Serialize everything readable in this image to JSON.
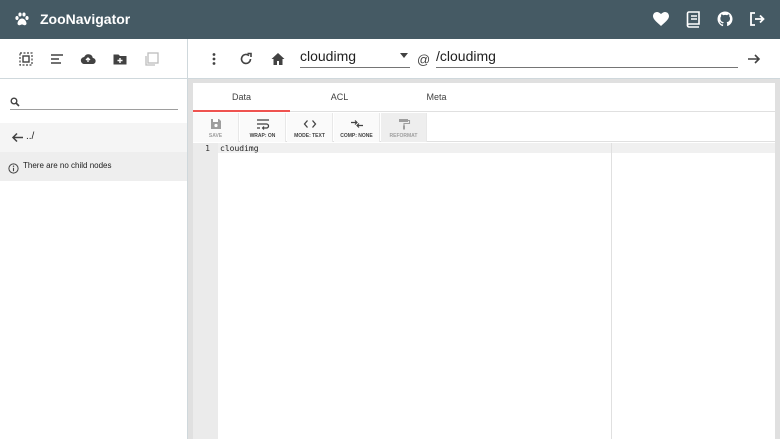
{
  "app": {
    "title": "ZooNavigator"
  },
  "sidebar": {
    "search_placeholder": "",
    "parent_label": "../",
    "empty_message": "There are no child nodes"
  },
  "node": {
    "selected": "cloudimg",
    "path": "/cloudimg"
  },
  "tabs": [
    {
      "label": "Data"
    },
    {
      "label": "ACL"
    },
    {
      "label": "Meta"
    }
  ],
  "editor_toolbar": {
    "save": "SAVE",
    "wrap": "WRAP: ON",
    "mode": "MODE: TEXT",
    "comp": "COMP: NONE",
    "reformat": "REFORMAT"
  },
  "editor": {
    "line_number": "1",
    "content": "cloudimg"
  },
  "colors": {
    "appbar": "#455a64",
    "active_tab": "#ef5350"
  }
}
